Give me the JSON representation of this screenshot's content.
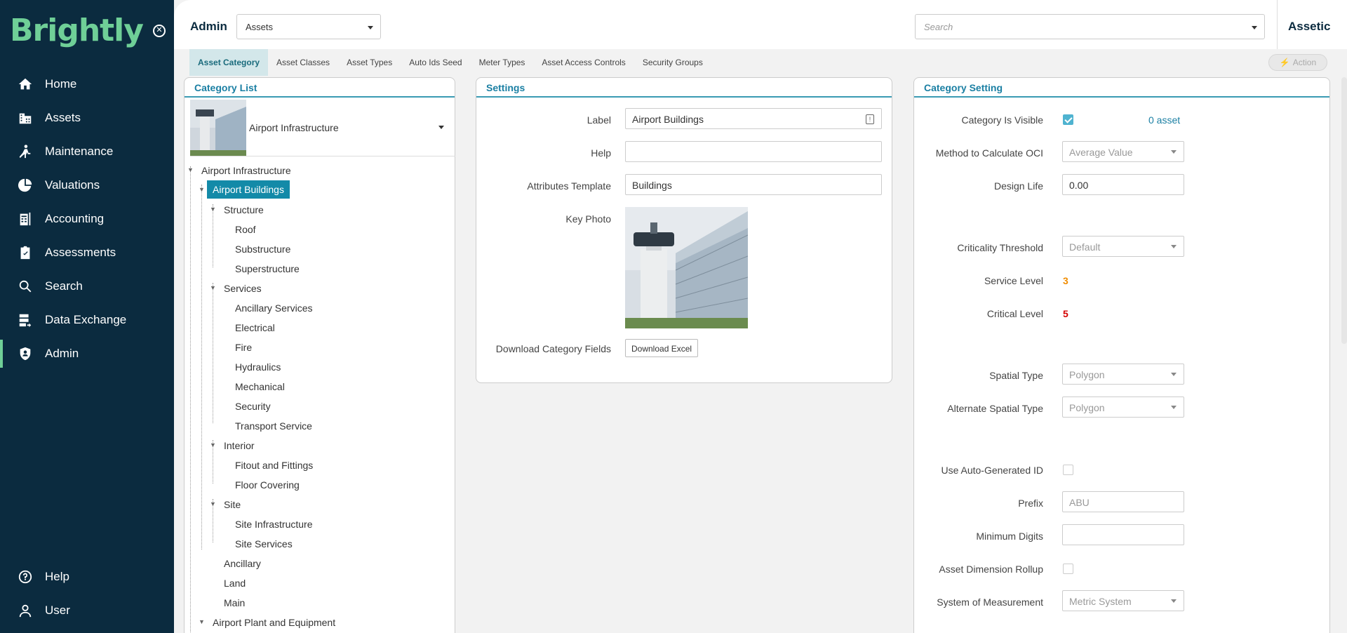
{
  "sidebar": {
    "logo": "Brightly",
    "nav": [
      {
        "label": "Home",
        "icon": "home-icon"
      },
      {
        "label": "Assets",
        "icon": "assets-icon"
      },
      {
        "label": "Maintenance",
        "icon": "maintenance-icon"
      },
      {
        "label": "Valuations",
        "icon": "valuations-icon"
      },
      {
        "label": "Accounting",
        "icon": "accounting-icon"
      },
      {
        "label": "Assessments",
        "icon": "assessments-icon"
      },
      {
        "label": "Search",
        "icon": "search-icon"
      },
      {
        "label": "Data Exchange",
        "icon": "data-exchange-icon"
      },
      {
        "label": "Admin",
        "icon": "admin-icon",
        "active": true
      }
    ],
    "bottom": [
      {
        "label": "Help",
        "icon": "help-icon"
      },
      {
        "label": "User",
        "icon": "user-icon"
      }
    ]
  },
  "header": {
    "title": "Admin",
    "module_select": "Assets",
    "search_placeholder": "Search",
    "tenant": "Assetic"
  },
  "tabs": [
    "Asset Category",
    "Asset Classes",
    "Asset Types",
    "Auto Ids Seed",
    "Meter Types",
    "Asset Access Controls",
    "Security Groups"
  ],
  "action_label": "Action",
  "category_list": {
    "title": "Category List",
    "selected": "Airport Infrastructure",
    "tree": [
      {
        "label": "Airport Infrastructure"
      },
      {
        "label": "Airport Buildings"
      },
      {
        "label": "Structure"
      },
      {
        "label": "Roof"
      },
      {
        "label": "Substructure"
      },
      {
        "label": "Superstructure"
      },
      {
        "label": "Services"
      },
      {
        "label": "Ancillary Services"
      },
      {
        "label": "Electrical"
      },
      {
        "label": "Fire"
      },
      {
        "label": "Hydraulics"
      },
      {
        "label": "Mechanical"
      },
      {
        "label": "Security"
      },
      {
        "label": "Transport Service"
      },
      {
        "label": "Interior"
      },
      {
        "label": "Fitout and Fittings"
      },
      {
        "label": "Floor Covering"
      },
      {
        "label": "Site"
      },
      {
        "label": "Site Infrastructure"
      },
      {
        "label": "Site Services"
      },
      {
        "label": "Ancillary"
      },
      {
        "label": "Land"
      },
      {
        "label": "Main"
      },
      {
        "label": "Airport Plant and Equipment"
      }
    ]
  },
  "settings": {
    "title": "Settings",
    "label_label": "Label",
    "label_value": "Airport Buildings",
    "help_label": "Help",
    "help_value": "",
    "template_label": "Attributes Template",
    "template_value": "Buildings",
    "photo_label": "Key Photo",
    "download_label": "Download Category Fields",
    "download_button": "Download Excel"
  },
  "category_setting": {
    "title": "Category Setting",
    "visible_label": "Category Is Visible",
    "visible_checked": true,
    "asset_count": "0 asset",
    "oci_label": "Method to Calculate OCI",
    "oci_value": "Average Value",
    "design_life_label": "Design Life",
    "design_life_value": "0.00",
    "criticality_label": "Criticality Threshold",
    "criticality_value": "Default",
    "service_level_label": "Service Level",
    "service_level_value": "3",
    "critical_level_label": "Critical Level",
    "critical_level_value": "5",
    "spatial_label": "Spatial Type",
    "spatial_value": "Polygon",
    "alt_spatial_label": "Alternate Spatial Type",
    "alt_spatial_value": "Polygon",
    "auto_id_label": "Use Auto-Generated ID",
    "prefix_label": "Prefix",
    "prefix_placeholder": "ABU",
    "min_digits_label": "Minimum Digits",
    "rollup_label": "Asset Dimension Rollup",
    "measurement_label": "System of Measurement",
    "measurement_value": "Metric System"
  },
  "colors": {
    "sidebar_bg": "#0b2b3f",
    "brand_green": "#6fcf97",
    "accent": "#1a7fa3",
    "selected_bg": "#138aa8",
    "service_level": "#f08c00",
    "critical_level": "#d40000"
  }
}
